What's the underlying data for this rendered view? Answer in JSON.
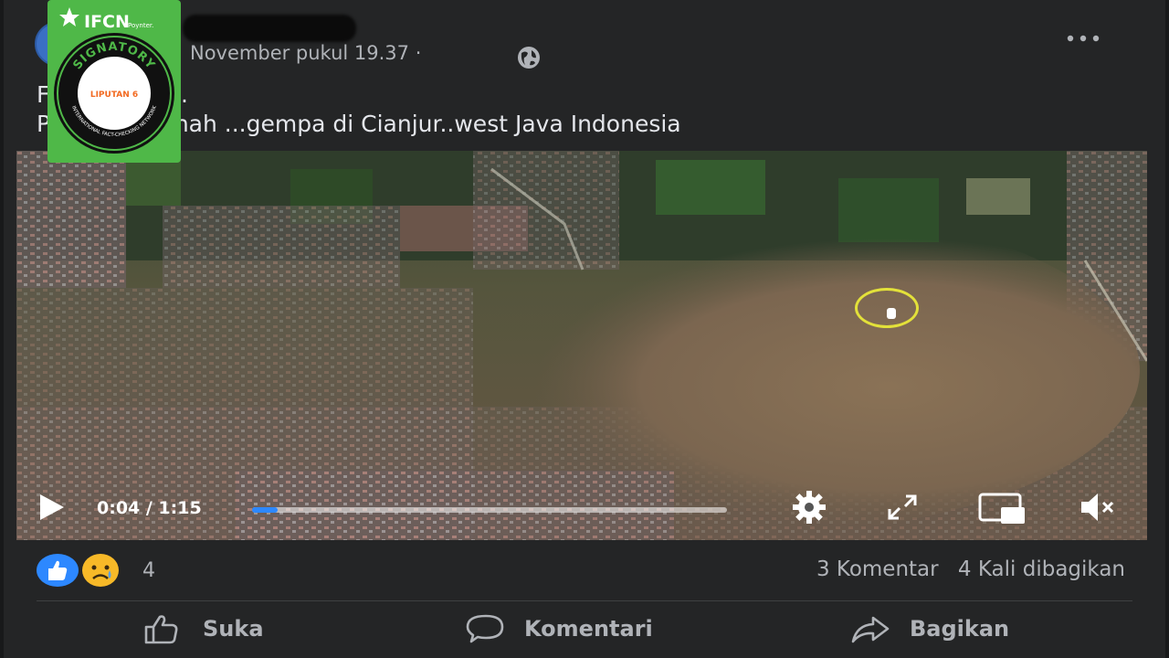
{
  "post": {
    "timestamp": "November pukul 19.37 ·",
    "text_line1": "F         atelit..",
    "text_line2": "P         an tanah ...gempa di Cianjur..west Java Indonesia"
  },
  "video": {
    "time_display": "0:04 / 1:15",
    "progress": 0.053
  },
  "footer": {
    "reaction_count": "4",
    "comments": "3 Komentar",
    "shares": "4 Kali dibagikan",
    "like_label": "Suka",
    "comment_label": "Komentari",
    "share_label": "Bagikan"
  },
  "badge": {
    "org": "IFCN",
    "org_sub": "Poynter.",
    "ring_top": "SIGNATORY",
    "ring_bottom": "INTERNATIONAL FACT-CHECKING NETWORK",
    "member": "LIPUTAN 6"
  },
  "colors": {
    "background": "#242526",
    "accent": "#2d88ff",
    "badge_green": "#4fb848"
  },
  "icons": [
    "globe-icon",
    "more-icon",
    "play-icon",
    "gear-icon",
    "fullscreen-icon",
    "pip-icon",
    "mute-icon",
    "like-icon",
    "sad-icon",
    "comment-icon",
    "share-icon"
  ]
}
